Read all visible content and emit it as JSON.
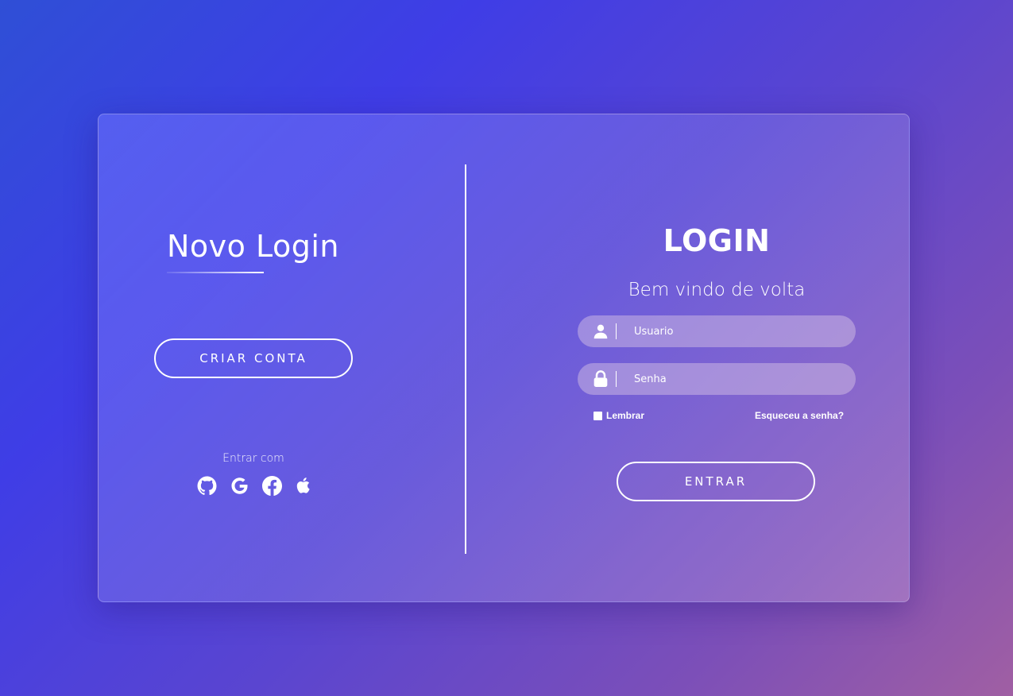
{
  "left_panel": {
    "title": "Novo Login",
    "create_button_label": "CRIAR CONTA",
    "social_label": "Entrar com",
    "social_icons": [
      "github-icon",
      "google-icon",
      "facebook-icon",
      "apple-icon"
    ]
  },
  "right_panel": {
    "title": "LOGIN",
    "subtitle": "Bem vindo de volta",
    "username": {
      "placeholder": "Usuario",
      "value": "",
      "icon": "user-icon"
    },
    "password": {
      "placeholder": "Senha",
      "value": "",
      "icon": "lock-icon"
    },
    "remember_label": "Lembrar",
    "forgot_label": "Esqueceu a senha?",
    "enter_button_label": "ENTRAR"
  },
  "colors": {
    "text": "#ffffff",
    "bg_start": "#2f4fd6",
    "bg_end": "#a05fa3"
  }
}
